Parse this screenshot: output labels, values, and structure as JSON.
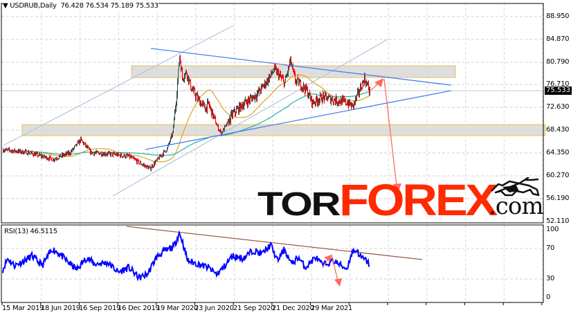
{
  "header": {
    "symbol_timeframe": "USDRUB,Daily",
    "ohlc": "76.428 76.534 75.189 75.533",
    "dropdown_icon": "triangle-down-icon"
  },
  "price_axis": {
    "ticks": [
      "88.950",
      "84.870",
      "80.790",
      "76.710",
      "72.630",
      "68.430",
      "64.350",
      "60.270",
      "56.190",
      "52.110"
    ],
    "current_price": "75.533"
  },
  "rsi": {
    "title": "RSI(13) 46.5115",
    "ticks": [
      "100",
      "70",
      "30",
      "0"
    ]
  },
  "time_axis": {
    "ticks": [
      "15 Mar 2019",
      "18 Jun 2019",
      "16 Sep 2019",
      "16 Dec 2019",
      "19 Mar 2020",
      "23 Jun 2020",
      "21 Sep 2020",
      "21 Dec 2020",
      "29 Mar 2021"
    ]
  },
  "logo": {
    "part1": "TOR",
    "part2": "FOREX",
    "part3": ".com"
  },
  "colors": {
    "bull_candle": "#2f4f4f",
    "bear_candle": "#ff0000",
    "ma_fast": "#daa520",
    "ma_slow": "#20b2aa",
    "trendline": "#4682ee",
    "channel": "#b0c4de",
    "arrow": "#ff6a5a",
    "rsi_line": "#0000ff",
    "rsi_trend": "#a05a50",
    "brand_red": "#ff2a00"
  },
  "chart_data": {
    "type": "candlestick",
    "instrument": "USDRUB",
    "timeframe": "Daily",
    "ylim": [
      52.11,
      88.95
    ],
    "close_keypoints_bar_price": [
      [
        0,
        65.0
      ],
      [
        37,
        64.5
      ],
      [
        72,
        63.3
      ],
      [
        97,
        64.5
      ],
      [
        112,
        66.8
      ],
      [
        127,
        64.5
      ],
      [
        157,
        64.2
      ],
      [
        182,
        63.8
      ],
      [
        202,
        62.3
      ],
      [
        212,
        61.6
      ],
      [
        227,
        63.8
      ],
      [
        237,
        65.2
      ],
      [
        245,
        68
      ],
      [
        250,
        74
      ],
      [
        255,
        82
      ],
      [
        259,
        78
      ],
      [
        265,
        79
      ],
      [
        272,
        76
      ],
      [
        282,
        74
      ],
      [
        292,
        72.5
      ],
      [
        297,
        73.2
      ],
      [
        309,
        69.3
      ],
      [
        315,
        68.0
      ],
      [
        322,
        69.3
      ],
      [
        332,
        71.5
      ],
      [
        347,
        73.2
      ],
      [
        367,
        75
      ],
      [
        382,
        77.5
      ],
      [
        392,
        79.5
      ],
      [
        407,
        77
      ],
      [
        415,
        81
      ],
      [
        422,
        77.5
      ],
      [
        437,
        76
      ],
      [
        447,
        73.5
      ],
      [
        462,
        74.5
      ],
      [
        477,
        74.0
      ],
      [
        497,
        73.5
      ],
      [
        505,
        72.8
      ],
      [
        512,
        74.8
      ],
      [
        522,
        77.8
      ],
      [
        530,
        75.5
      ]
    ],
    "rsi_keypoints_bar_value": [
      [
        0,
        42
      ],
      [
        7,
        58
      ],
      [
        17,
        48
      ],
      [
        32,
        55
      ],
      [
        42,
        62
      ],
      [
        57,
        48
      ],
      [
        72,
        72
      ],
      [
        82,
        65
      ],
      [
        92,
        55
      ],
      [
        107,
        42
      ],
      [
        122,
        60
      ],
      [
        132,
        50
      ],
      [
        152,
        52
      ],
      [
        167,
        38
      ],
      [
        182,
        45
      ],
      [
        197,
        30
      ],
      [
        209,
        35
      ],
      [
        222,
        60
      ],
      [
        232,
        68
      ],
      [
        247,
        75
      ],
      [
        255,
        95
      ],
      [
        259,
        85
      ],
      [
        267,
        55
      ],
      [
        282,
        50
      ],
      [
        297,
        45
      ],
      [
        309,
        35
      ],
      [
        319,
        45
      ],
      [
        332,
        62
      ],
      [
        347,
        58
      ],
      [
        362,
        70
      ],
      [
        375,
        65
      ],
      [
        387,
        78
      ],
      [
        397,
        55
      ],
      [
        407,
        72
      ],
      [
        417,
        50
      ],
      [
        427,
        60
      ],
      [
        437,
        45
      ],
      [
        452,
        60
      ],
      [
        462,
        48
      ],
      [
        477,
        55
      ],
      [
        497,
        43
      ],
      [
        505,
        68
      ],
      [
        512,
        70
      ],
      [
        517,
        60
      ],
      [
        525,
        55
      ],
      [
        532,
        46.5
      ]
    ]
  }
}
